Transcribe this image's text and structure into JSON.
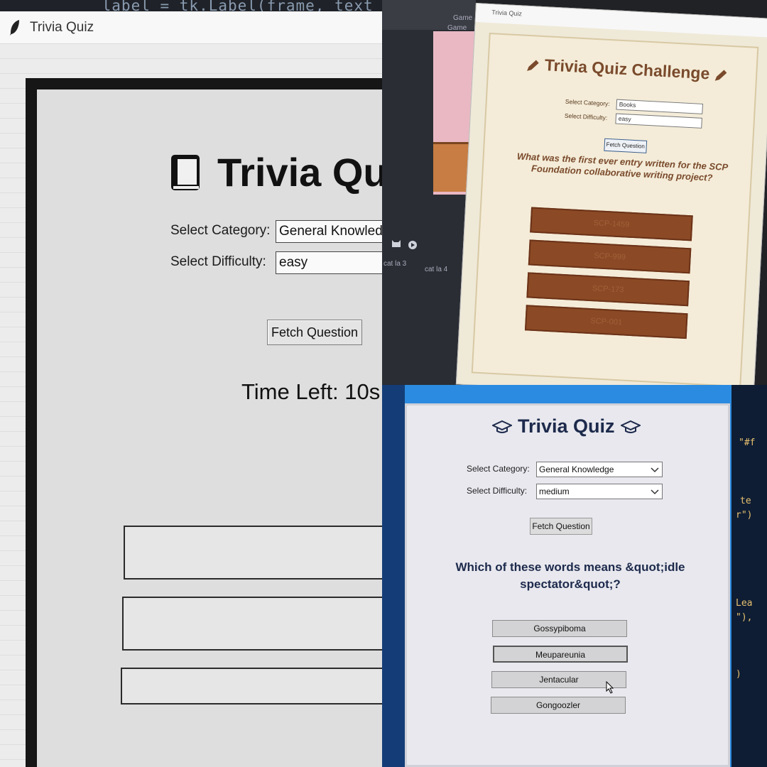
{
  "panel_a": {
    "code_fragment": "_label = tk.Label(frame, text",
    "window_title": "Trivia Quiz",
    "heading": "Trivia Qu",
    "category_label": "Select Category:",
    "category_value": "General Knowledg",
    "difficulty_label": "Select Difficulty:",
    "difficulty_value": "easy",
    "fetch_button": "Fetch Question",
    "timer": "Time Left: 10s"
  },
  "panel_b": {
    "editor_tab_1": "Game",
    "editor_tab_2": "Game",
    "editor_label_1": "cat la 3",
    "editor_label_2": "cat la 4",
    "window_title": "Trivia Quiz",
    "heading": "Trivia Quiz Challenge",
    "category_label": "Select Category:",
    "category_value": "Books",
    "difficulty_label": "Select Difficulty:",
    "difficulty_value": "easy",
    "fetch_button": "Fetch Question",
    "question": "What was the first ever entry written for the SCP Foundation collaborative writing project?",
    "answers": [
      "SCP-1459",
      "SCP-999",
      "SCP-173",
      "SCP-001"
    ]
  },
  "panel_c": {
    "code_right_1": "\"#f",
    "code_right_2": "te",
    "code_right_3": "r\")",
    "code_right_4": "Lea",
    "code_right_5": "\"),",
    "code_right_6": ")",
    "heading": "Trivia Quiz",
    "category_label": "Select Category:",
    "category_value": "General Knowledge",
    "difficulty_label": "Select Difficulty:",
    "difficulty_value": "medium",
    "fetch_button": "Fetch Question",
    "question": "Which of these words means &quot;idle spectator&quot;?",
    "answers": [
      "Gossypiboma",
      "Meupareunia",
      "Jentacular",
      "Gongoozler"
    ]
  },
  "colors": {
    "challenge_brown": "#7a4a2c",
    "answer_brown": "#8b4a25",
    "quiz_navy": "#1d2a4c"
  }
}
